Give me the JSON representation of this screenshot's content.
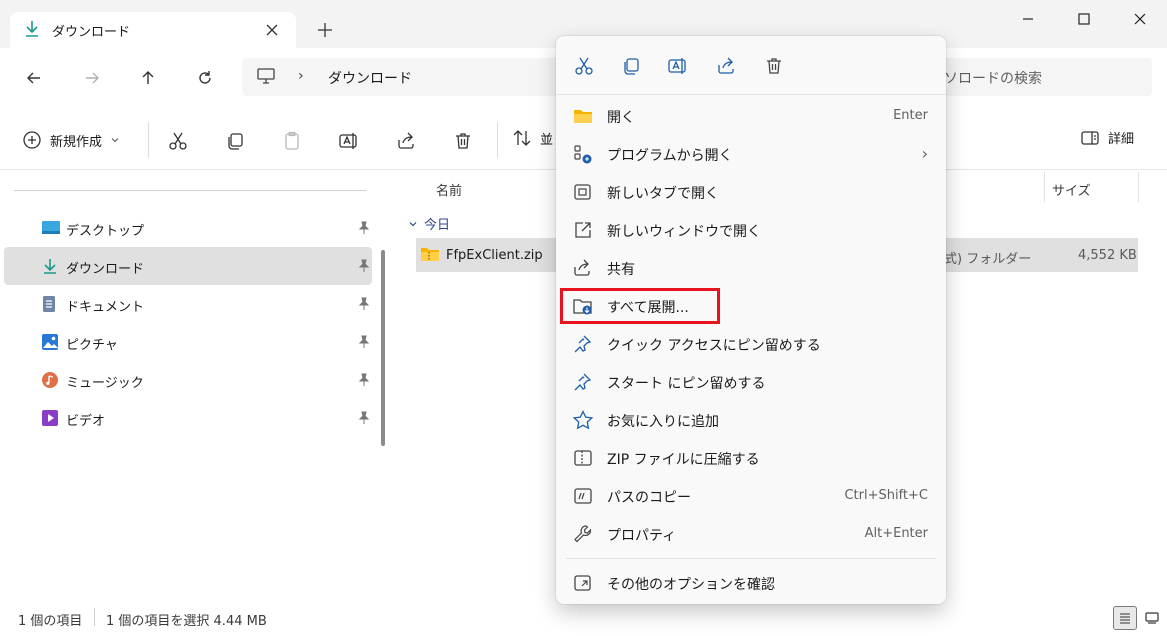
{
  "window": {
    "tab_title": "ダウンロード",
    "new_tab_symbol": "+"
  },
  "address": {
    "separator": "›",
    "folder": "ダウンロード",
    "search_placeholder": "ソロードの検索"
  },
  "command_bar": {
    "new_label": "新規作成",
    "sort_label": "並",
    "details_label": "詳細"
  },
  "nav": {
    "items": [
      {
        "label": "デスクトップ",
        "icon": "desktop-icon"
      },
      {
        "label": "ダウンロード",
        "icon": "download-icon"
      },
      {
        "label": "ドキュメント",
        "icon": "document-icon"
      },
      {
        "label": "ピクチャ",
        "icon": "pictures-icon"
      },
      {
        "label": "ミュージック",
        "icon": "music-icon"
      },
      {
        "label": "ビデオ",
        "icon": "video-icon"
      }
    ]
  },
  "file_list": {
    "col_name": "名前",
    "col_size": "サイズ",
    "group": "今日",
    "files": [
      {
        "name": "FfpExClient.zip",
        "type": "式) フォルダー",
        "size": "4,552 KB"
      }
    ]
  },
  "status": {
    "count": "1 個の項目",
    "selected": "1 個の項目を選択  4.44 MB"
  },
  "context_menu": {
    "items": [
      {
        "label": "開く",
        "shortcut": "Enter"
      },
      {
        "label": "プログラムから開く",
        "shortcut": "›"
      },
      {
        "label": "新しいタブで開く",
        "shortcut": ""
      },
      {
        "label": "新しいウィンドウで開く",
        "shortcut": ""
      },
      {
        "label": "共有",
        "shortcut": ""
      },
      {
        "label": "すべて展開...",
        "shortcut": ""
      },
      {
        "label": "クイック アクセスにピン留めする",
        "shortcut": ""
      },
      {
        "label": "スタート にピン留めする",
        "shortcut": ""
      },
      {
        "label": "お気に入りに追加",
        "shortcut": ""
      },
      {
        "label": "ZIP ファイルに圧縮する",
        "shortcut": ""
      },
      {
        "label": "パスのコピー",
        "shortcut": "Ctrl+Shift+C"
      },
      {
        "label": "プロパティ",
        "shortcut": "Alt+Enter"
      }
    ],
    "more_options": "その他のオプションを確認"
  },
  "colors": {
    "highlight": "#e8121e",
    "accent": "#0067c0",
    "folder": "#f4b400"
  }
}
